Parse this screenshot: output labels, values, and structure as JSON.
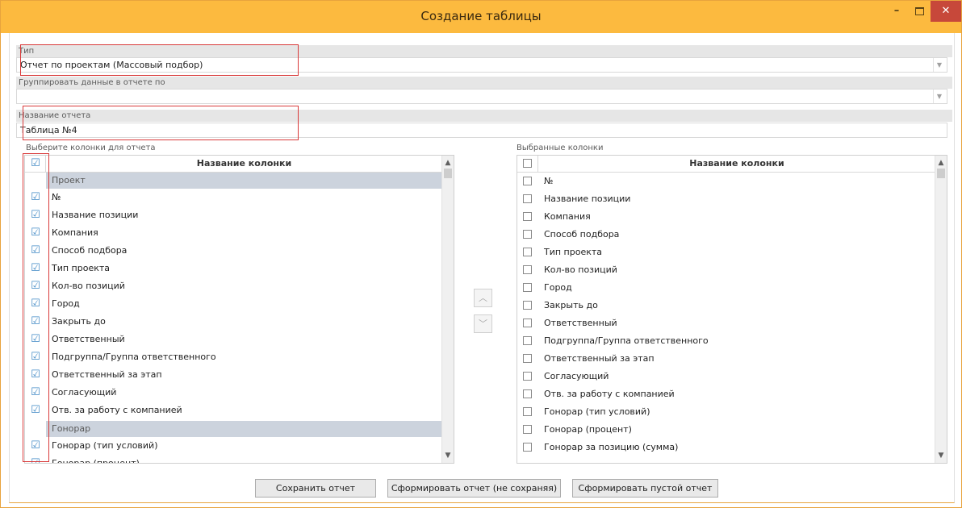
{
  "window": {
    "title": "Создание таблицы",
    "close_glyph": "✕",
    "min_glyph": "–"
  },
  "form": {
    "type_label": "Тип",
    "type_value": "Отчет по проектам (Массовый подбор)",
    "group_label": "Группировать данные в отчете по",
    "group_value": "",
    "name_label": "Название отчета",
    "name_value": "Таблица №4"
  },
  "left_panel": {
    "label": "Выберите колонки для отчета",
    "column_header": "Название колонки",
    "group_proekt": "Проект",
    "group_gonorar": "Гонорар",
    "items": [
      "№",
      "Название позиции",
      "Компания",
      "Способ подбора",
      "Тип проекта",
      "Кол-во позиций",
      "Город",
      "Закрыть до",
      "Ответственный",
      "Подгруппа/Группа ответственного",
      "Ответственный за этап",
      "Согласующий",
      "Отв. за работу с компанией"
    ],
    "gonorar_items": [
      "Гонорар (тип условий)",
      "Гонорар (процент)"
    ]
  },
  "right_panel": {
    "label": "Выбранные колонки",
    "column_header": "Название колонки",
    "items": [
      "№",
      "Название позиции",
      "Компания",
      "Способ подбора",
      "Тип проекта",
      "Кол-во позиций",
      "Город",
      "Закрыть до",
      "Ответственный",
      "Подгруппа/Группа ответственного",
      "Ответственный за этап",
      "Согласующий",
      "Отв. за работу с компанией",
      "Гонорар (тип условий)",
      "Гонорар (процент)",
      "Гонорар за позицию (сумма)"
    ]
  },
  "buttons": {
    "save": "Сохранить отчет",
    "generate": "Сформировать отчет (не сохраняя)",
    "empty": "Сформировать пустой отчет"
  },
  "colors": {
    "titlebar": "#fcba3f",
    "accent": "#3f88c5",
    "highlight": "#d93a3a"
  }
}
